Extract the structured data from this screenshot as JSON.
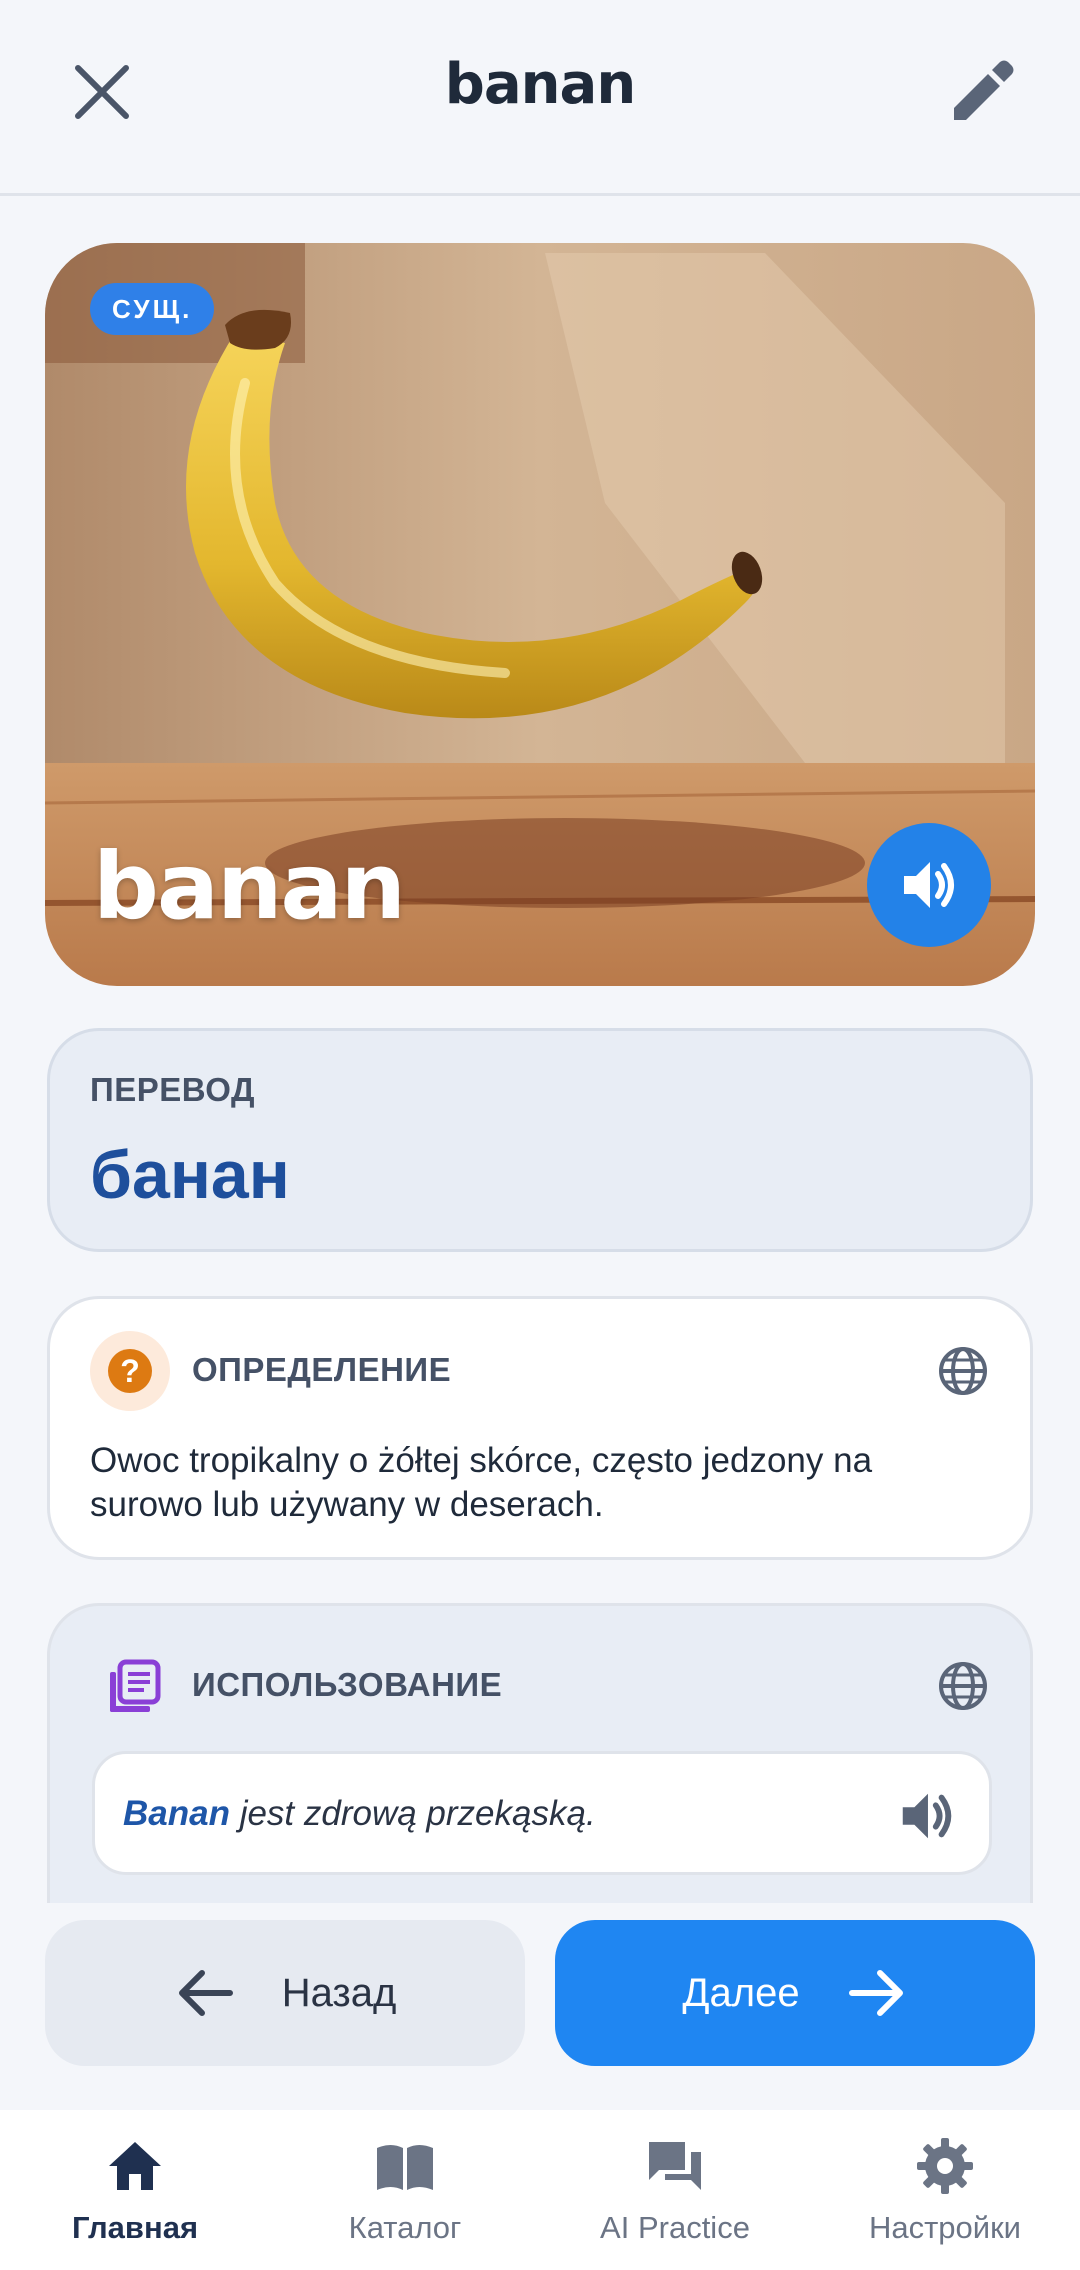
{
  "header": {
    "title": "banan",
    "close_icon": "close-icon",
    "edit_icon": "pencil-icon"
  },
  "hero": {
    "badge": "СУЩ.",
    "word": "banan",
    "audio_icon": "speaker-icon"
  },
  "translation": {
    "label": "ПЕРЕВОД",
    "value": "банан"
  },
  "definition": {
    "icon": "question-icon",
    "label": "ОПРЕДЕЛЕНИЕ",
    "globe_icon": "globe-icon",
    "text": "Owoc tropikalny o żółtej skórce, często jedzony na surowo lub używany w deserach."
  },
  "usage": {
    "icon": "list-icon",
    "label": "ИСПОЛЬЗОВАНИЕ",
    "globe_icon": "globe-icon",
    "example_word": "Banan",
    "example_rest": " jest zdrową przekąską.",
    "audio_icon": "speaker-icon"
  },
  "buttons": {
    "back": "Назад",
    "next": "Далее"
  },
  "tabs": [
    {
      "label": "Главная",
      "icon": "home-icon",
      "active": true
    },
    {
      "label": "Каталог",
      "icon": "book-icon",
      "active": false
    },
    {
      "label": "AI Practice",
      "icon": "chat-icon",
      "active": false
    },
    {
      "label": "Настройки",
      "icon": "gear-icon",
      "active": false
    }
  ],
  "colors": {
    "accent": "#1f86f2",
    "translation_text": "#1e4f9c",
    "definition_icon": "#dd7a12",
    "usage_icon": "#8a3fd6"
  }
}
